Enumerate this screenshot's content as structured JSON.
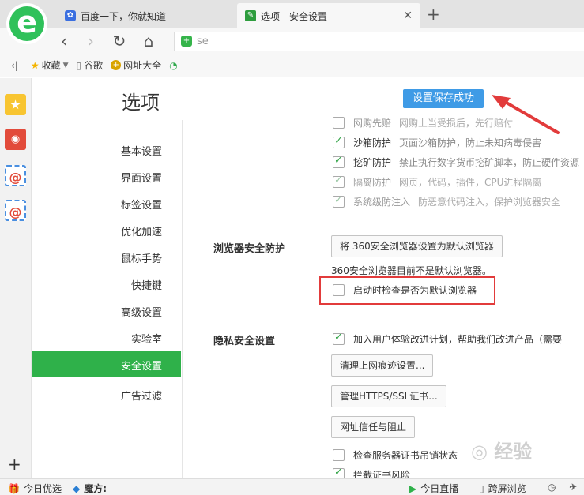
{
  "browser": {
    "tabs": [
      {
        "label": "百度一下，你就知道",
        "icon": "baidu-paw-icon"
      },
      {
        "label": "选项 - 安全设置",
        "icon": "wrench-icon"
      }
    ],
    "tab_close_glyph": "✕",
    "new_tab_glyph": "+",
    "nav": {
      "back": "‹",
      "forward": "›",
      "reload": "↻",
      "home": "⌂"
    },
    "address_text": "se"
  },
  "bookmarks": [
    {
      "label": "收藏",
      "icon": "star-icon"
    },
    {
      "label": "谷歌",
      "icon": "document-icon"
    },
    {
      "label": "网址大全",
      "icon": "site-nav-icon"
    }
  ],
  "settings": {
    "title": "选项",
    "toast": "设置保存成功",
    "menu": [
      "基本设置",
      "界面设置",
      "标签设置",
      "优化加速",
      "鼠标手势",
      "快捷键",
      "高级设置",
      "实验室",
      "安全设置",
      "广告过滤"
    ],
    "active_menu": "安全设置",
    "protections": [
      {
        "label": "网购先赔",
        "desc": "网购上当受损后，先行赔付",
        "checked": false
      },
      {
        "label": "沙箱防护",
        "desc": "页面沙箱防护，防止未知病毒侵害",
        "checked": true
      },
      {
        "label": "挖矿防护",
        "desc": "禁止执行数字货币挖矿脚本，防止硬件资源",
        "checked": true
      },
      {
        "label": "隔离防护",
        "desc": "网页，代码，插件，CPU进程隔离",
        "checked": true
      },
      {
        "label": "系统级防注入",
        "desc": "防恶意代码注入，保护浏览器安全",
        "checked": true
      }
    ],
    "browser_protect": {
      "label": "浏览器安全防护",
      "button": "将 360安全浏览器设置为默认浏览器",
      "note": "360安全浏览器目前不是默认浏览器。",
      "check_default": "启动时检查是否为默认浏览器"
    },
    "privacy": {
      "label": "隐私安全设置",
      "join_program": "加入用户体验改进计划，帮助我们改进产品（需要",
      "clear_button": "清理上网痕迹设置...",
      "https_button": "管理HTTPS/SSL证书...",
      "trust_button": "网址信任与阻止",
      "check_revocation": "检查服务器证书吊销状态",
      "block_cert_risk": "拦截证书风险"
    }
  },
  "statusbar": {
    "today_pick": "今日优选",
    "mofang": "魔方:",
    "live": "今日直播",
    "cross_screen": "跨屏浏览"
  },
  "watermark": "◎ 经验"
}
